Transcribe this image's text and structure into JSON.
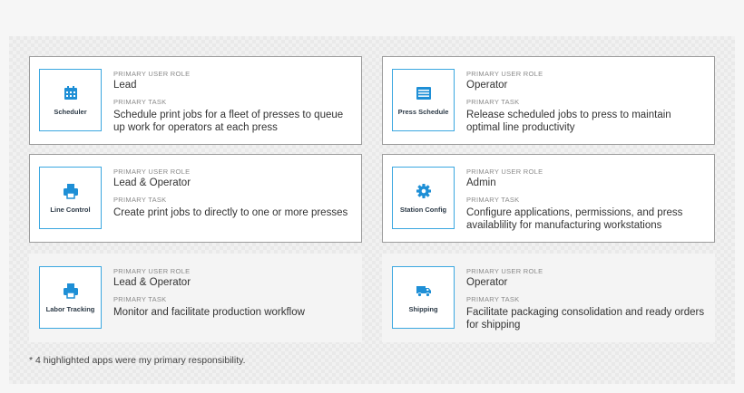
{
  "labels": {
    "role": "PRIMARY USER ROLE",
    "task": "PRIMARY TASK"
  },
  "apps": [
    {
      "name": "Scheduler",
      "icon": "calendar-icon",
      "role": "Lead",
      "task": "Schedule print jobs for a fleet of presses to queue up work for operators at each press",
      "highlighted": true
    },
    {
      "name": "Press Schedule",
      "icon": "schedule-list-icon",
      "role": "Operator",
      "task": "Release scheduled jobs to press to maintain optimal line productivity",
      "highlighted": true
    },
    {
      "name": "Line Control",
      "icon": "printer-icon",
      "role": "Lead & Operator",
      "task": "Create print jobs to directly to one or more presses",
      "highlighted": true
    },
    {
      "name": "Station Config",
      "icon": "gear-icon",
      "role": "Admin",
      "task": "Configure applications, permissions, and press availablility for manufacturing workstations",
      "highlighted": true
    },
    {
      "name": "Labor Tracking",
      "icon": "printer-icon",
      "role": "Lead & Operator",
      "task": "Monitor and facilitate production workflow",
      "highlighted": false
    },
    {
      "name": "Shipping",
      "icon": "truck-icon",
      "role": "Operator",
      "task": "Facilitate packaging consolidation and ready orders for shipping",
      "highlighted": false
    }
  ],
  "footnote": "* 4 highlighted apps were my primary responsibility.",
  "colors": {
    "accent": "#1e8fd6",
    "border_accent": "#3aa7e0"
  }
}
